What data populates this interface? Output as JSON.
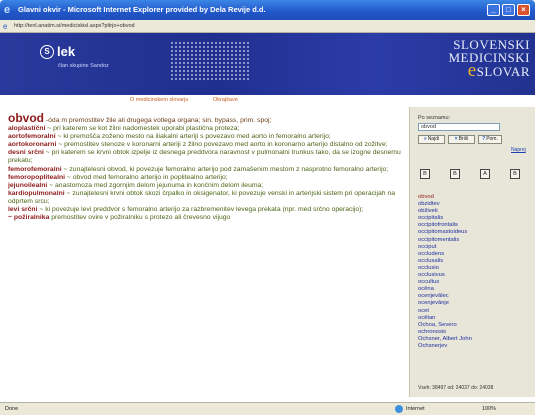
{
  "window": {
    "title": "Glavni okvir - Microsoft Internet Explorer provided by Dela Revije d.d.",
    "address": "http://tenl.anatim.si/mediciskisl.aspx?pltrjo+obvod"
  },
  "header": {
    "logo_text": "lek",
    "logo_subtext": "član skupine Sandoz",
    "dict_line1": "SLOVENSKI",
    "dict_line2": "MEDICINSKI",
    "dict_line3_initial": "e",
    "dict_line3_rest": "SLOVAR"
  },
  "toplinks": {
    "about": "O medicinskem slovarju",
    "abbrev": "Okrajšave"
  },
  "content": {
    "headword": "obvod",
    "first_def": "-óda m premostitev žile ali drugega votlega organa; sin. bypass, prim. spoj;",
    "entries": [
      {
        "term": "aloplastični",
        "def": "~ pri katerem se kot žilni nadomestek uporabi plastična proteza;"
      },
      {
        "term": "aortofemoralni",
        "def": "~ ki premošča zoženo mesto na iliakalni arteriji s povezavo med aorto in femoralno arterijo;"
      },
      {
        "term": "aortokoronarni",
        "def": "~ premostitev stenoze v koronarni arteriji z žilno povezavo med aorto in koronarno arterijo distalno od zožitve;"
      },
      {
        "term": "desni srčni",
        "def": "~ pri katerem se krvni obtok izpelje iz desnega preddvora naravnost v pulmonalni trunkus tako, da se izogne desnemu prekatu;"
      },
      {
        "term": "femorofemoralni",
        "def": "~ zunajtelesni obvod, ki povezuje femoralno arterijo pod zamašenim mestom z nasprotno femoralno arterijo;"
      },
      {
        "term": "femoropoplitealni",
        "def": "~ obvod med femoralno arterijo in poplitealno arterijo;"
      },
      {
        "term": "jejunoilealni",
        "def": "~ anastomoza med zgornjim delom jejunuma in končnim delom ileuma;"
      },
      {
        "term": "kardiopulmonalni",
        "def": "~ zunajtelesni krvni obtok skozi črpalko in oksigenator, ki povezuje venski in arterijski sistem pri operacijah na odprtem srcu;"
      },
      {
        "term": "levi srčni",
        "def": "~ ki povezuje levi preddvor s femoralno arterijo za razbremenitev levega prekata (npr. med srčno operacijo);"
      },
      {
        "term": "~ požiralnika",
        "def": "premostitev ovire v požiralniku s protezo ali črevesno vijugo"
      }
    ]
  },
  "sidepanel": {
    "label": "Po seznamu:",
    "search_value": "obvod",
    "btn_find": "Najdi",
    "btn_clear": "Briši",
    "btn_help": "Pom.",
    "forward_link": "Naprej",
    "letters": [
      "B",
      "B",
      "A",
      "B"
    ],
    "words": [
      "obvod",
      "obzidtev",
      "obživeti",
      "occipitalis",
      "occipitofrontalis",
      "occipitomastoideus",
      "occipitomentalis",
      "occiput",
      "occludens",
      "occlusalis",
      "occlusio",
      "occlusivus",
      "occultus",
      "ocêna",
      "ocenjevâlec",
      "ocenjevânje",
      "ocet",
      "ocêtan",
      "Ochoa, Severo",
      "ochronosis",
      "Ochsner, Albert John",
      "Ochsnerjev"
    ],
    "count_text": "Vseh: 38497 od: 24037 do: 24038"
  },
  "status": {
    "left": "Done",
    "zone": "Internet",
    "zoom": "100%"
  },
  "colors": {
    "headword": "#8e1a1a",
    "definition": "#4d6416",
    "link": "#1d2f9e",
    "banner": "#2a3a9c"
  }
}
